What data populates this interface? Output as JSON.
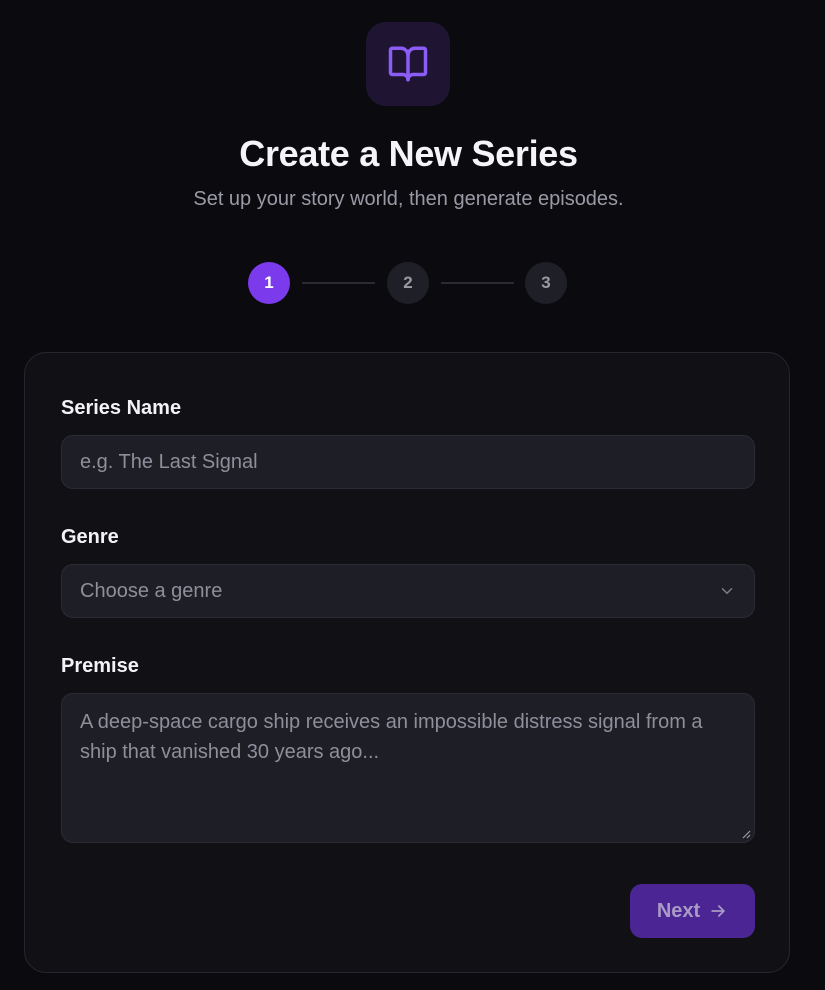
{
  "header": {
    "icon": "book-open-icon",
    "title": "Create a New Series",
    "subtitle": "Set up your story world, then generate episodes."
  },
  "stepper": {
    "current_step": 1,
    "steps": [
      "1",
      "2",
      "3"
    ]
  },
  "form": {
    "series_name": {
      "label": "Series Name",
      "value": "",
      "placeholder": "e.g. The Last Signal"
    },
    "genre": {
      "label": "Genre",
      "selected": "Choose a genre",
      "icon": "chevron-down-icon"
    },
    "premise": {
      "label": "Premise",
      "value": "",
      "placeholder": "A deep-space cargo ship receives an impossible distress signal from a ship that vanished 30 years ago..."
    },
    "next_button": {
      "label": "Next",
      "icon": "arrow-right-icon"
    }
  },
  "colors": {
    "background": "#0b0b0f",
    "accent": "#7c3aed",
    "card": "#111115",
    "field": "#1e1e27",
    "button_disabled": "#4c2595"
  }
}
